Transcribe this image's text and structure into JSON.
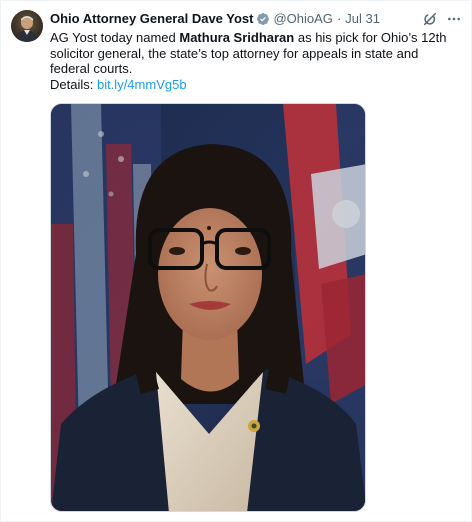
{
  "author": {
    "display_name": "Ohio Attorney General Dave Yost",
    "handle": "@OhioAG",
    "separator": "·",
    "date": "Jul 31"
  },
  "tweet": {
    "text_1": "AG Yost today named ",
    "highlight_name": "Mathura Sridharan",
    "text_2": " as his pick for Ohio’s 12th solicitor general, the state’s top attorney for appeals in state and federal courts.",
    "details_label": "Details: ",
    "details_link": "bit.ly/4mmVg5b"
  },
  "icons": {
    "avatar": "avatar-portrait",
    "verified": "verified-badge-icon",
    "grok": "grok-icon",
    "more": "more-options-icon"
  },
  "colors": {
    "link": "#1d9bf0",
    "secondary_text": "#536471",
    "verified_badge": "#829aab"
  }
}
